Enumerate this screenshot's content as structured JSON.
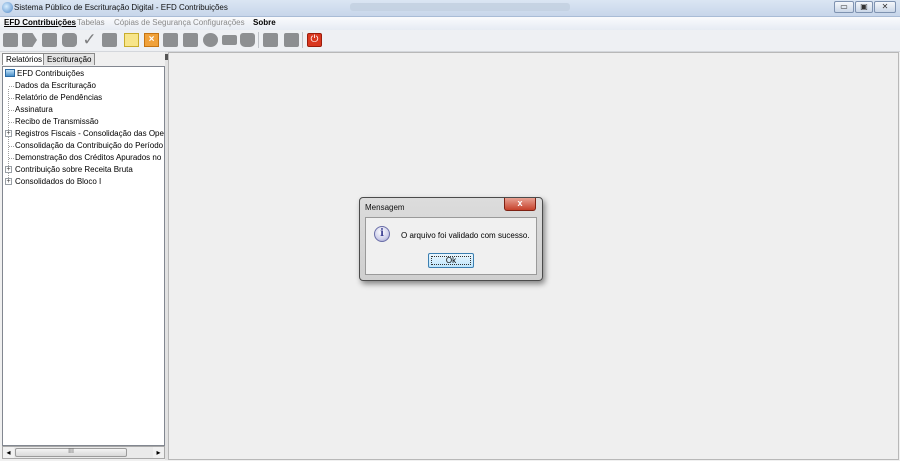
{
  "window": {
    "title": "Sistema Público de Escrituração Digital - EFD Contribuições",
    "controls": {
      "minimize": "▭",
      "maximize": "▣",
      "close": "✕"
    }
  },
  "menubar": {
    "items": [
      {
        "label": "EFD Contribuições",
        "enabled": true
      },
      {
        "label": "Tabelas",
        "enabled": false
      },
      {
        "label": "Cópias de Segurança",
        "enabled": false
      },
      {
        "label": "Configurações",
        "enabled": false
      },
      {
        "label": "Sobre",
        "enabled": true
      }
    ]
  },
  "toolbar": {
    "icons": [
      "new-file-icon",
      "open-file-icon",
      "folder-icon",
      "import-icon",
      "validate-check-icon",
      "print-icon",
      "notepad-icon",
      "remove-icon",
      "sign-icon",
      "transmit-icon",
      "globe-icon",
      "envelope-icon",
      "bag-icon",
      "save-icon",
      "save-as-icon",
      "power-icon"
    ]
  },
  "leftpanel": {
    "tabs": [
      "Relatórios",
      "Escrituração"
    ],
    "active_tab": "Relatórios",
    "tree": {
      "root": "EFD Contribuições",
      "items": [
        {
          "label": "Dados da Escrituração",
          "expandable": false
        },
        {
          "label": "Relatório de Pendências",
          "expandable": false
        },
        {
          "label": "Assinatura",
          "expandable": false
        },
        {
          "label": "Recibo de Transmissão",
          "expandable": false
        },
        {
          "label": "Registros Fiscais - Consolidação das Operaçõ",
          "expandable": true
        },
        {
          "label": "Consolidação da Contribuição do Período",
          "expandable": false
        },
        {
          "label": "Demonstração dos Créditos Apurados no Perí",
          "expandable": false
        },
        {
          "label": "Contribuição sobre Receita Bruta",
          "expandable": true
        },
        {
          "label": "Consolidados do Bloco I",
          "expandable": true
        }
      ]
    },
    "scrollbar": {
      "left": "◂",
      "right": "▸",
      "thumb_grip": "III"
    }
  },
  "dialog": {
    "title": "Mensagem",
    "close_label": "x",
    "icon": "info-icon",
    "icon_glyph": "i",
    "message": "O arquivo foi validado com sucesso.",
    "ok_label": "Ok"
  }
}
